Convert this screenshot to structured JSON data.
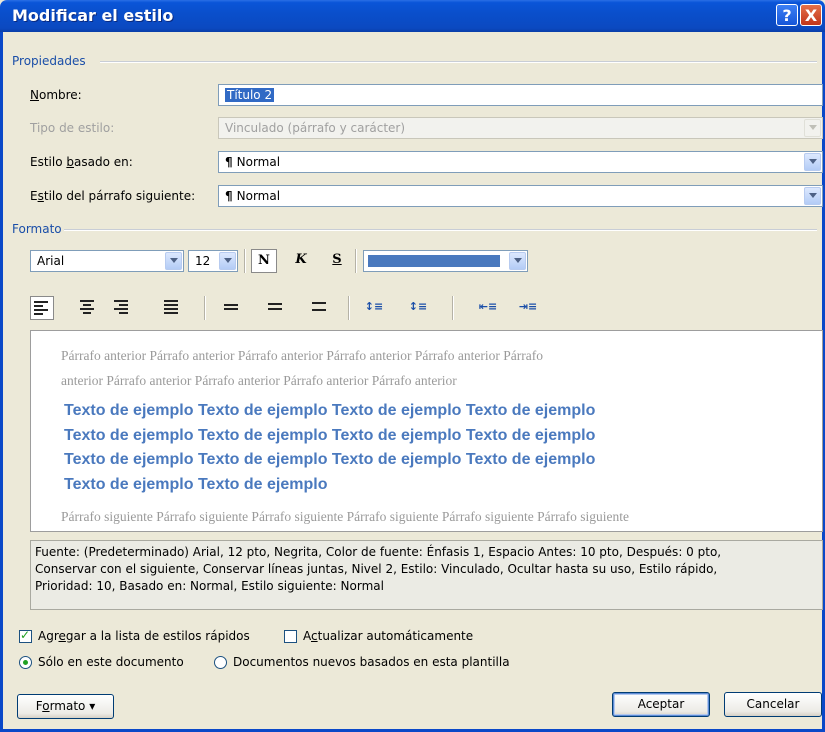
{
  "window": {
    "title": "Modificar el estilo",
    "help_label": "?",
    "close_label": "X"
  },
  "properties": {
    "section_label": "Propiedades",
    "name_label_pre": "",
    "name_label_u": "N",
    "name_label_post": "ombre:",
    "name_value": "Título 2",
    "type_label": "Tipo de estilo:",
    "type_value": "Vinculado (párrafo y carácter)",
    "based_label_pre": "Estilo ",
    "based_label_u": "b",
    "based_label_post": "asado en:",
    "based_value": "Normal",
    "next_label_pre": "E",
    "next_label_u": "s",
    "next_label_post": "tilo del párrafo siguiente:",
    "next_value": "Normal",
    "pilcrow": "¶"
  },
  "format": {
    "section_label": "Formato",
    "font_name": "Arial",
    "font_size": "12",
    "bold_label": "N",
    "italic_label": "K",
    "underline_label": "S",
    "color_hex": "#4a79be"
  },
  "preview": {
    "prev_line1": "Párrafo anterior Párrafo anterior Párrafo anterior Párrafo anterior Párrafo anterior Párrafo",
    "prev_line2": "anterior Párrafo anterior Párrafo anterior Párrafo anterior Párrafo anterior",
    "sample_line1": "Texto de ejemplo Texto de ejemplo Texto de ejemplo Texto de ejemplo",
    "sample_line2": "Texto de ejemplo Texto de ejemplo Texto de ejemplo Texto de ejemplo",
    "sample_line3": "Texto de ejemplo Texto de ejemplo Texto de ejemplo Texto de ejemplo",
    "sample_line4": "Texto de ejemplo Texto de ejemplo",
    "next_line": "Párrafo siguiente Párrafo siguiente Párrafo siguiente Párrafo siguiente Párrafo siguiente Párrafo siguiente"
  },
  "description": {
    "line1": "Fuente: (Predeterminado) Arial, 12 pto, Negrita, Color de fuente: Énfasis 1, Espacio Antes:  10 pto, Después:  0 pto,",
    "line2": "Conservar con el siguiente, Conservar líneas juntas, Nivel 2, Estilo: Vinculado, Ocultar hasta su uso, Estilo rápido,",
    "line3": "Prioridad: 10, Basado en: Normal, Estilo siguiente: Normal"
  },
  "options": {
    "quick_pre": "Agr",
    "quick_u": "e",
    "quick_post": "gar a la lista de estilos rápidos",
    "quick_checked": true,
    "auto_pre": "A",
    "auto_u": "c",
    "auto_post": "tualizar automáticamente",
    "auto_checked": false,
    "only_doc_label": "Sólo en este documento",
    "only_doc_selected": true,
    "new_docs_label": "Documentos nuevos basados en esta plantilla",
    "new_docs_selected": false
  },
  "buttons": {
    "format_pre": "F",
    "format_u": "o",
    "format_post": "rmato",
    "format_arrow": "▾",
    "ok_label": "Aceptar",
    "cancel_label": "Cancelar"
  }
}
